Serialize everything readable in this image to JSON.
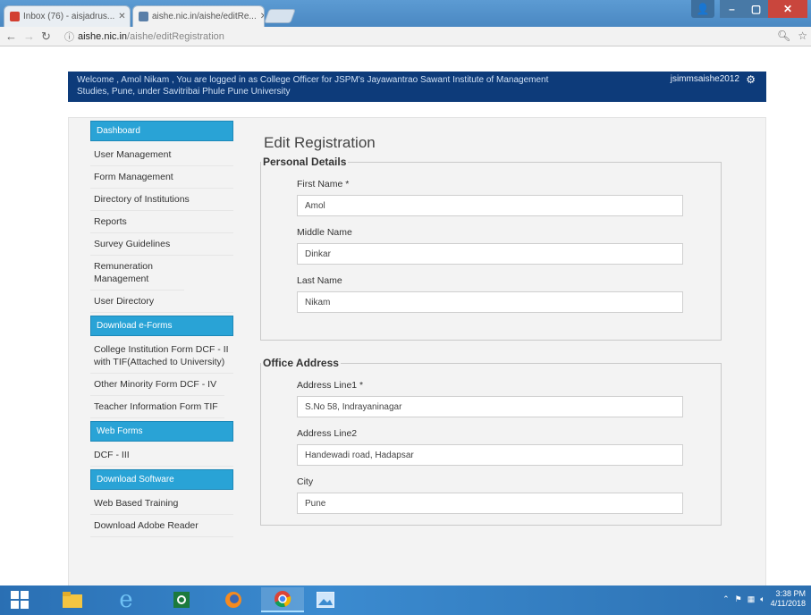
{
  "browser": {
    "tabs": [
      {
        "title": "Inbox (76) - aisjadrus..."
      },
      {
        "title": "aishe.nic.in/aishe/editRe..."
      }
    ],
    "url_host": "aishe.nic.in",
    "url_path": "/aishe/editRegistration"
  },
  "header": {
    "welcome": "Welcome , Amol Nikam , You are logged in as College Officer for JSPM's Jayawantrao Sawant Institute of Management Studies, Pune, under Savitribai Phule Pune University",
    "username": "jsimmsaishe2012"
  },
  "sidebar": {
    "dashboard": "Dashboard",
    "items1": [
      "User Management",
      "Form Management",
      "Directory of Institutions",
      "Reports",
      "Survey Guidelines",
      "Remuneration Management",
      "User Directory"
    ],
    "download_forms": "Download e-Forms",
    "items2": [
      "College Institution Form DCF - II with TIF(Attached to University)",
      "Other Minority Form DCF - IV",
      "Teacher Information Form TIF"
    ],
    "web_forms": "Web Forms",
    "items3": [
      "DCF - III"
    ],
    "download_software": "Download Software",
    "items4": [
      "Web Based Training",
      "Download Adobe Reader"
    ]
  },
  "main": {
    "title": "Edit Registration",
    "personal": {
      "legend": "Personal Details",
      "first_name_label": "First Name *",
      "first_name": "Amol",
      "middle_name_label": "Middle Name",
      "middle_name": "Dinkar",
      "last_name_label": "Last Name",
      "last_name": "Nikam"
    },
    "office": {
      "legend": "Office Address",
      "addr1_label": "Address Line1 *",
      "addr1": "S.No 58, Indrayaninagar",
      "addr2_label": "Address Line2",
      "addr2": "Handewadi road, Hadapsar",
      "city_label": "City",
      "city": "Pune"
    }
  },
  "taskbar": {
    "time": "3:38 PM",
    "date": "4/11/2018"
  },
  "colors": {
    "header_bg": "#0d3b7a",
    "sidebar_header": "#29a3d6",
    "taskbar": "#2a6fb3"
  }
}
